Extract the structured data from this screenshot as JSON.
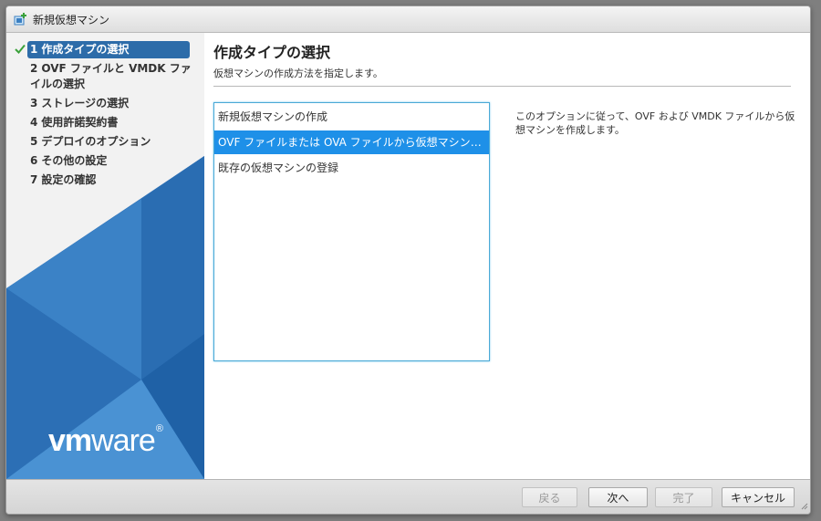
{
  "window": {
    "title": "新規仮想マシン",
    "icon": "new-vm-icon"
  },
  "sidebar": {
    "steps": [
      {
        "num": "1",
        "label": "作成タイプの選択",
        "state": "active",
        "completed": true
      },
      {
        "num": "2",
        "label": "OVF ファイルと VMDK ファイルの選択",
        "state": "pending"
      },
      {
        "num": "3",
        "label": "ストレージの選択",
        "state": "pending"
      },
      {
        "num": "4",
        "label": "使用許諾契約書",
        "state": "pending"
      },
      {
        "num": "5",
        "label": "デプロイのオプション",
        "state": "pending"
      },
      {
        "num": "6",
        "label": "その他の設定",
        "state": "pending"
      },
      {
        "num": "7",
        "label": "設定の確認",
        "state": "pending"
      }
    ],
    "logo": {
      "vm": "vm",
      "ware": "ware",
      "reg": "®"
    }
  },
  "main": {
    "title": "作成タイプの選択",
    "subtitle": "仮想マシンの作成方法を指定します。",
    "options": [
      {
        "label": "新規仮想マシンの作成",
        "selected": false
      },
      {
        "label": "OVF ファイルまたは OVA ファイルから仮想マシンをデ...",
        "selected": true
      },
      {
        "label": "既存の仮想マシンの登録",
        "selected": false
      }
    ],
    "description": "このオプションに従って、OVF および VMDK ファイルから仮想マシンを作成します。"
  },
  "footer": {
    "back": "戻る",
    "next": "次へ",
    "finish": "完了",
    "cancel": "キャンセル"
  },
  "colors": {
    "accent": "#2d6ca9",
    "selection": "#1e90e8",
    "listbox_border": "#4aa9d6",
    "sidebar_blue": "#3a7fc2"
  }
}
